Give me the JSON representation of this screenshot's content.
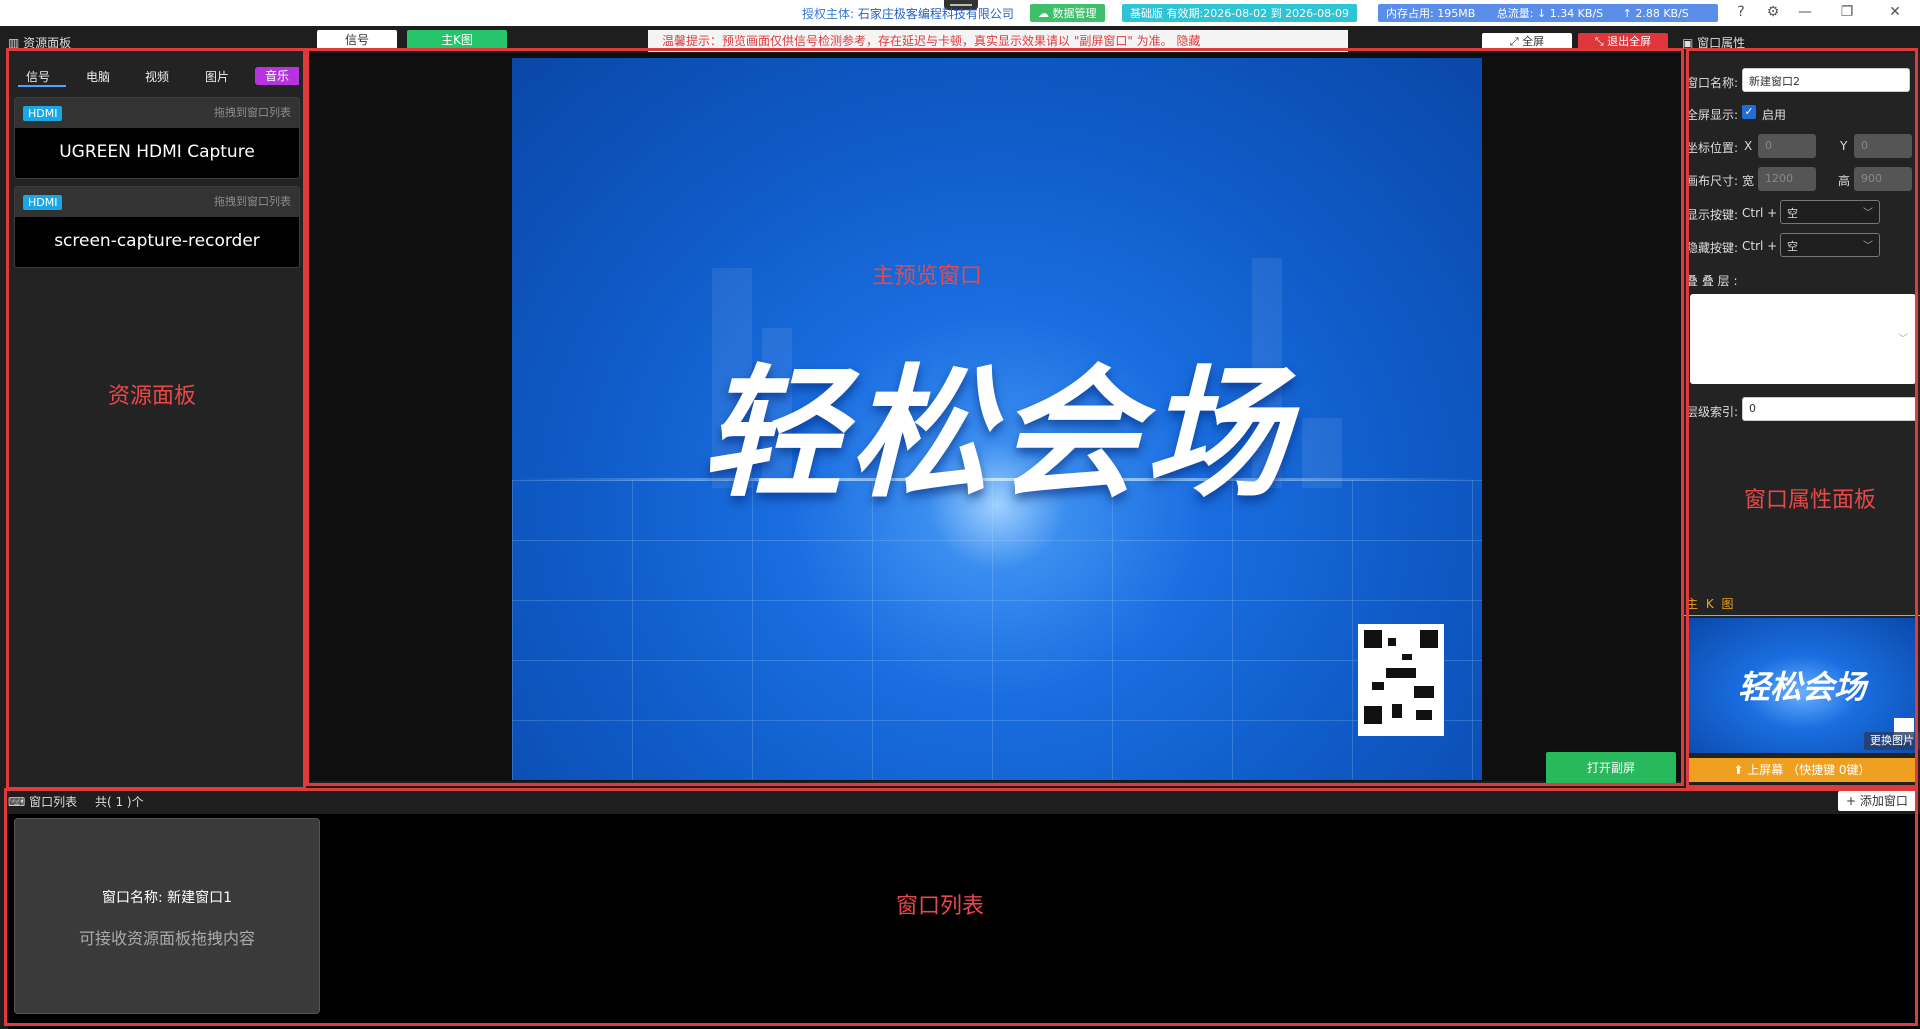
{
  "titlebar": {
    "license_label": "授权主体:",
    "license_org": "石家庄极客编程科技有限公司",
    "data_mgmt": "数据管理",
    "plan": "基础版 有效期:2026-08-02 到 2026-08-09",
    "memory_label": "内存占用:",
    "memory_value": "195MB",
    "traffic_label": "总流量:",
    "down": "↓ 1.34 KB/S",
    "up": "↑ 2.88 KB/S"
  },
  "toolbar": {
    "tab_signal": "信号",
    "tab_kmain": "主K图",
    "notice": "温馨提示：预览画面仅供信号检测参考，存在延迟与卡顿，真实显示效果请以 \"副屏窗口\" 为准。   隐藏",
    "fullscreen": "全屏",
    "exit_fullscreen": "退出全屏"
  },
  "resource_panel": {
    "header": "资源面板",
    "tabs": [
      "信号",
      "电脑",
      "视频",
      "图片",
      "音乐"
    ],
    "cards": [
      {
        "badge": "HDMI",
        "hint": "拖拽到窗口列表",
        "name": "UGREEN HDMI Capture"
      },
      {
        "badge": "HDMI",
        "hint": "拖拽到窗口列表",
        "name": "screen-capture-recorder"
      }
    ],
    "annotation": "资源面板"
  },
  "preview": {
    "title": "轻松会场",
    "annotation": "主预览窗口",
    "open_sub_screen": "打开副屏"
  },
  "properties": {
    "header": "窗口属性",
    "name_label": "窗口名称:",
    "name_value": "新建窗口2",
    "fullscreen_label": "全屏显示:",
    "fullscreen_enable": "启用",
    "pos_label": "坐标位置:",
    "x_label": "X",
    "x_value": "0",
    "y_label": "Y",
    "y_value": "0",
    "size_label": "画布尺寸:",
    "w_label": "宽",
    "w_value": "1200",
    "h_label": "高",
    "h_value": "900",
    "show_key_label": "显示按键:",
    "hide_key_label": "隐藏按键:",
    "ctrl": "Ctrl +",
    "show_key_value": "空",
    "hide_key_value": "空",
    "overlay_label": "叠 叠 层 :",
    "zindex_label": "层级索引:",
    "zindex_value": "0",
    "annotation": "窗口属性面板",
    "kmain_label": "主 K 图",
    "kmain_thumb_title": "轻松会场",
    "change_pic": "更换图片",
    "on_screen": "⬆ 上屏幕 （快捷键 0键）"
  },
  "window_list": {
    "header": "窗口列表",
    "count": "共( 1 )个",
    "add_button": "添加窗口",
    "card_name": "窗口名称: 新建窗口1",
    "card_desc": "可接收资源面板拖拽内容",
    "annotation": "窗口列表"
  },
  "colors": {
    "accent_green": "#27c56b",
    "danger_red": "#e03b3b",
    "music_purple": "#b534e0",
    "hdmi_blue": "#18a8e6",
    "kmain_orange": "#f0a020"
  }
}
